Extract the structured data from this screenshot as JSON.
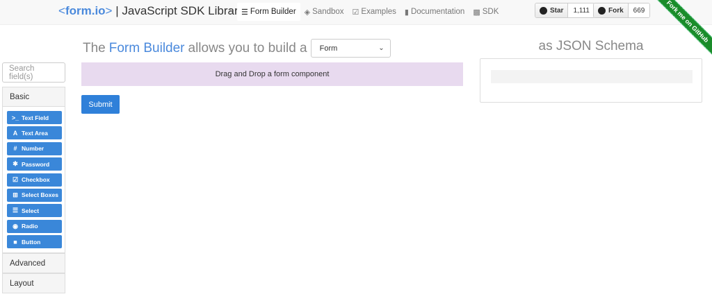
{
  "brand": {
    "lt": "<",
    "logo": "form.io",
    "gt": ">",
    "sep": "|",
    "title": "JavaScript SDK Library"
  },
  "nav": {
    "home_icon": "home-icon",
    "items": [
      {
        "label": "Form Builder",
        "icon": "list-icon",
        "active": true
      },
      {
        "label": "Sandbox",
        "icon": "cube-icon",
        "active": false
      },
      {
        "label": "Examples",
        "icon": "check-square-icon",
        "active": false
      },
      {
        "label": "Documentation",
        "icon": "book-icon",
        "active": false
      },
      {
        "label": "SDK",
        "icon": "terminal-icon",
        "active": false
      }
    ]
  },
  "github": {
    "star_label": "Star",
    "star_count": "1,111",
    "fork_label": "Fork",
    "fork_count": "669",
    "ribbon": "Fork me on GitHub"
  },
  "headline": {
    "prefix": "The",
    "highlight": "Form Builder",
    "suffix": "allows you to build a",
    "select_value": "Form"
  },
  "json": {
    "title": "as JSON Schema"
  },
  "sidebar": {
    "search_placeholder": "Search field(s)",
    "groups": {
      "basic": "Basic",
      "advanced": "Advanced",
      "layout": "Layout"
    },
    "components": [
      {
        "label": "Text Field",
        "icon": "terminal-icon"
      },
      {
        "label": "Text Area",
        "icon": "font-icon"
      },
      {
        "label": "Number",
        "icon": "hashtag-icon"
      },
      {
        "label": "Password",
        "icon": "asterisk-icon"
      },
      {
        "label": "Checkbox",
        "icon": "check-square-icon"
      },
      {
        "label": "Select Boxes",
        "icon": "plus-square-icon"
      },
      {
        "label": "Select",
        "icon": "list-icon"
      },
      {
        "label": "Radio",
        "icon": "dot-circle-icon"
      },
      {
        "label": "Button",
        "icon": "stop-icon"
      }
    ]
  },
  "builder": {
    "dropzone_text": "Drag and Drop a form component",
    "submit_label": "Submit"
  },
  "colors": {
    "accent": "#4a89dc",
    "button": "#3a87d9",
    "dropzone": "#e8daef",
    "ribbon": "#1a8c2a"
  }
}
